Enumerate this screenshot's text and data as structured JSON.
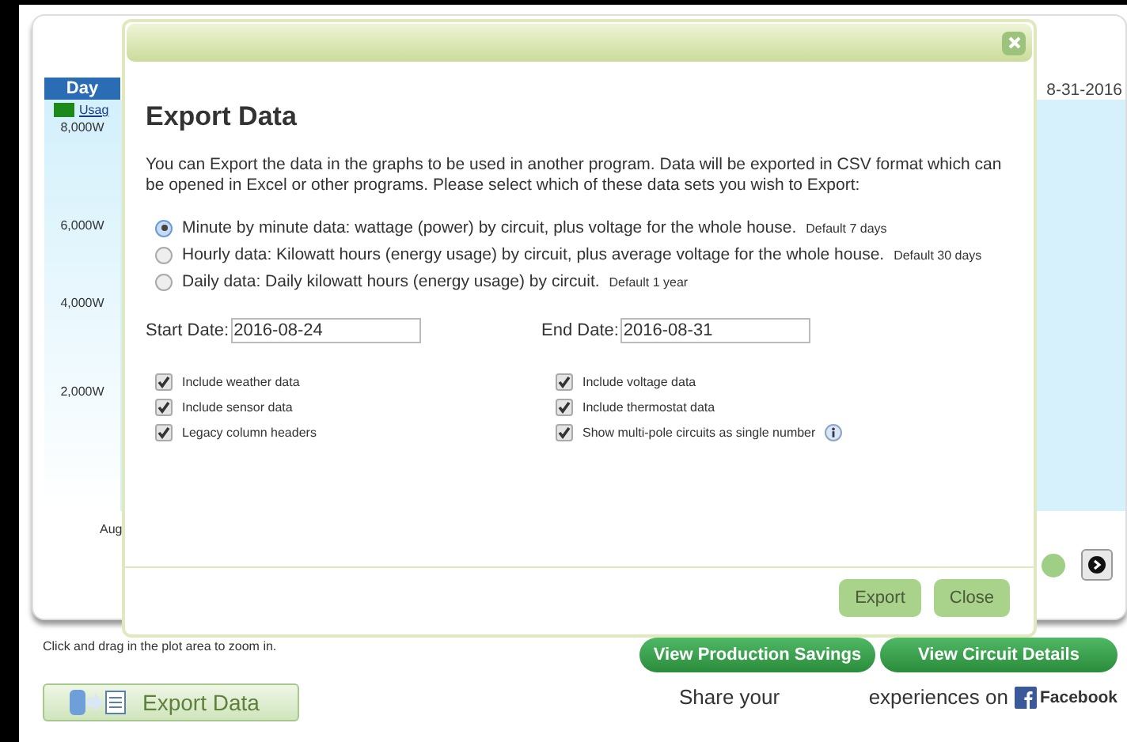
{
  "background": {
    "range_tab": "Day",
    "legend": "Usag",
    "y_labels": [
      "8,000W",
      "6,000W",
      "4,000W",
      "2,000W"
    ],
    "x_label": "Aug",
    "date": "8-31-2016",
    "hint": "Click and drag in the plot area to zoom in.",
    "export_button": "Export Data",
    "buttons": [
      "View Production Savings",
      "View Circuit Details"
    ],
    "share_text": "Share your",
    "share_text_2": "experiences on",
    "facebook": "Facebook"
  },
  "dialog": {
    "title": "Export Data",
    "description": "You can Export the data in the graphs to be used in another program. Data will be exported in CSV format which can be opened in Excel or other programs. Please select which of these data sets you wish to Export:",
    "options": [
      {
        "label": "Minute by minute data: wattage (power) by circuit, plus voltage for the whole house.",
        "note": "Default 7 days",
        "selected": true
      },
      {
        "label": "Hourly data: Kilowatt hours (energy usage) by circuit, plus average voltage for the whole house.",
        "note": "Default 30 days",
        "selected": false
      },
      {
        "label": "Daily data: Daily kilowatt hours (energy usage) by circuit.",
        "note": "Default 1 year",
        "selected": false
      }
    ],
    "start_date": {
      "label": "Start Date:",
      "value": "2016-08-24"
    },
    "end_date": {
      "label": "End Date:",
      "value": "2016-08-31"
    },
    "checkboxes": [
      {
        "label": "Include weather data",
        "checked": true,
        "info": false
      },
      {
        "label": "Include voltage data",
        "checked": true,
        "info": false
      },
      {
        "label": "Include sensor data",
        "checked": true,
        "info": false
      },
      {
        "label": "Include thermostat data",
        "checked": true,
        "info": false
      },
      {
        "label": "Legacy column headers",
        "checked": true,
        "info": false
      },
      {
        "label": "Show multi-pole circuits as single number",
        "checked": true,
        "info": true
      }
    ],
    "buttons": [
      "Export",
      "Close"
    ]
  }
}
